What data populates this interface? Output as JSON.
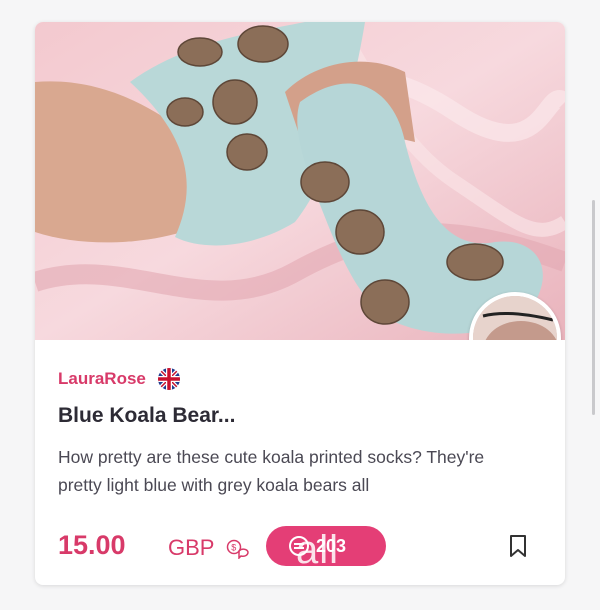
{
  "listing": {
    "seller": "LauraRose",
    "seller_flag": "uk-flag-icon",
    "title": "Blue Koala Bear...",
    "description": "How pretty are these cute koala printed socks? They're pretty light blue with grey koala bears all",
    "price": "15.00",
    "currency": "GBP",
    "boost_count": "203",
    "watermark": "all"
  },
  "colors": {
    "accent": "#d83a69",
    "boost": "#e43e76"
  },
  "icons": {
    "offer": "make-offer-icon",
    "boost": "boost-icon",
    "bookmark": "bookmark-icon"
  }
}
